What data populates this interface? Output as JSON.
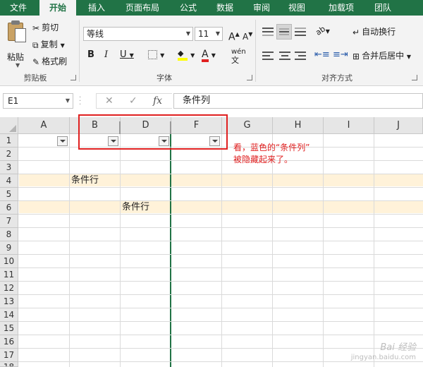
{
  "ribbon_tabs": [
    "文件",
    "开始",
    "插入",
    "页面布局",
    "公式",
    "数据",
    "审阅",
    "视图",
    "加载项",
    "团队"
  ],
  "clipboard": {
    "paste_label": "粘贴",
    "cut_label": "剪切",
    "copy_label": "复制",
    "format_painter_label": "格式刷",
    "group_label": "剪贴板"
  },
  "font": {
    "font_name": "等线",
    "font_size": "11",
    "grow_label": "A",
    "shrink_label": "A",
    "bold_label": "B",
    "italic_label": "I",
    "underline_label": "U",
    "font_color_label": "A",
    "phonetic_label": "wén",
    "group_label": "字体"
  },
  "alignment": {
    "wrap_label": "自动换行",
    "merge_label": "合并后居中",
    "group_label": "对齐方式"
  },
  "formula_bar": {
    "name_box": "E1",
    "fx_label": "fx",
    "value": "条件列"
  },
  "columns": [
    "A",
    "B",
    "D",
    "F",
    "G",
    "H",
    "I",
    "J"
  ],
  "rows": [
    "1",
    "2",
    "3",
    "4",
    "5",
    "6",
    "7",
    "8",
    "9",
    "10",
    "11",
    "12",
    "13",
    "14",
    "15",
    "16",
    "17",
    "18"
  ],
  "cells": {
    "b4": "条件行",
    "d6": "条件行"
  },
  "annotation": {
    "line1": "看，蓝色的“条件列”",
    "line2": "被隐藏起来了。"
  },
  "watermark": {
    "line1": "Bai 经验",
    "line2": "jingyan.baidu.com"
  },
  "colors": {
    "excel_green": "#217346",
    "band_fill": "#fff2d9",
    "annotation_red": "#e02020"
  }
}
